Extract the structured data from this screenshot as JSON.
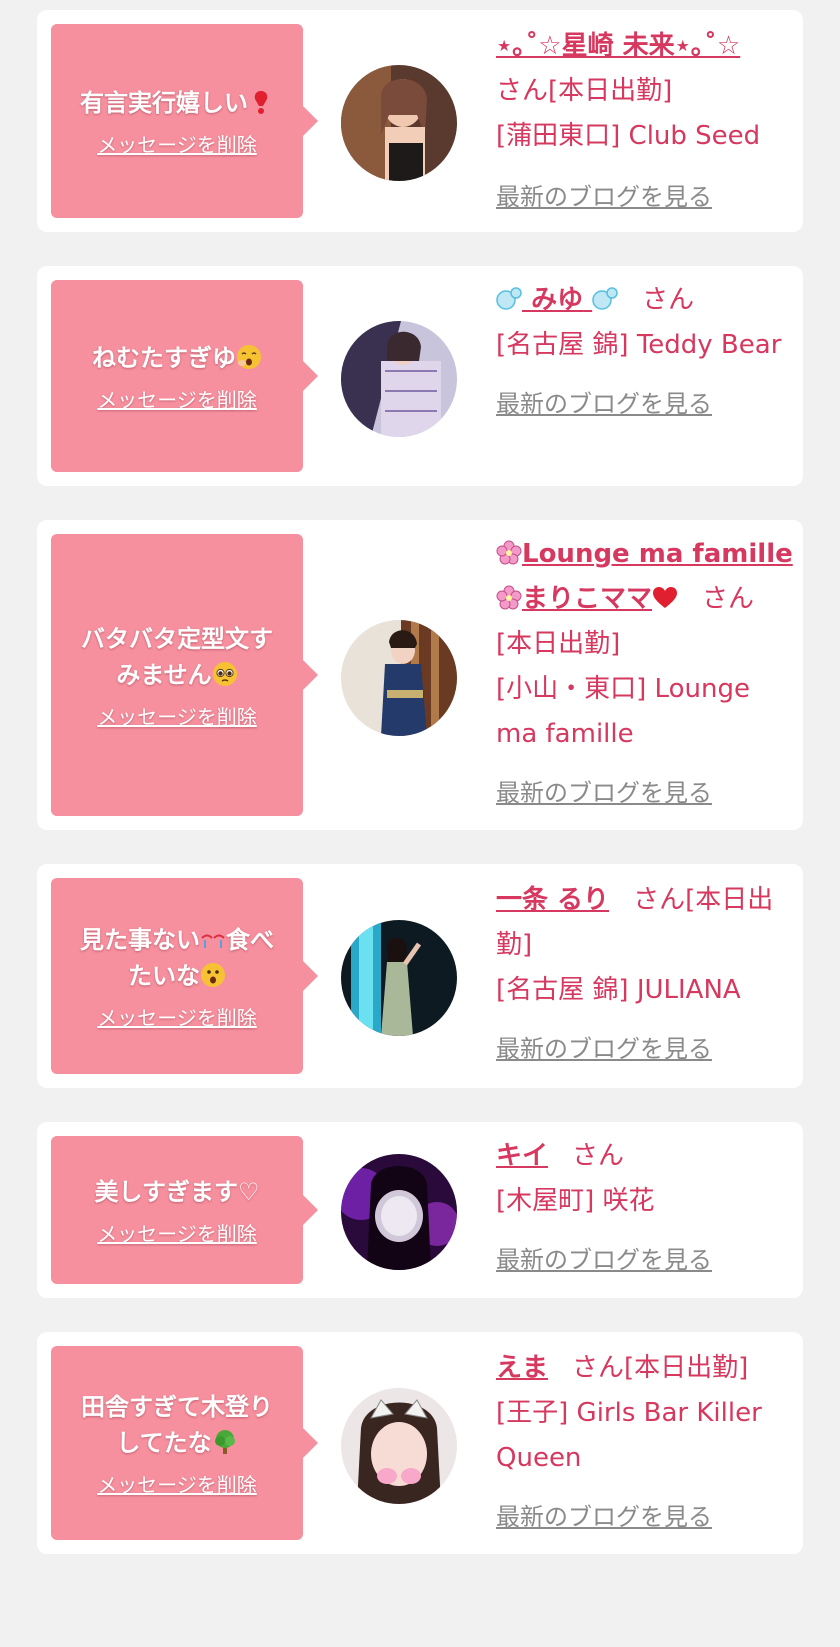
{
  "delete_label": "メッセージを削除",
  "blog_label": "最新のブログを見る",
  "honorific": "さん",
  "colors": {
    "bubble": "#f7909e",
    "accent": "#d6385f",
    "link_gray": "#8a8a8a",
    "background": "#f1f1f1"
  },
  "items": [
    {
      "message": "有言実行嬉しい",
      "message_emoji": "red-exclamation-icon",
      "name": "⋆｡˚☆星崎 未来⋆｡˚☆",
      "status": "[本日出勤]",
      "location": "[蒲田東口] Club Seed"
    },
    {
      "message": "ねむたすぎゆ",
      "message_emoji": "yawning-face-icon",
      "name": "みゆ",
      "name_emoji": "bubbles-icon",
      "status": "",
      "location": "[名古屋 錦] Teddy Bear"
    },
    {
      "message_line1": "バタバタ定型文す",
      "message_line2": "みません",
      "message_emoji": "pleading-face-icon",
      "name_line1": "Lounge ma famille",
      "name_line2": "まりこママ",
      "name_emoji": "cherry-blossom-icon",
      "name_end_emoji": "red-heart-icon",
      "status": "[本日出勤]",
      "location": "[小山・東口] Lounge ma famille"
    },
    {
      "message_line1": "見た事ない",
      "message_line1_end": "食べ",
      "message_line2": "たいな",
      "message_emoji1": "tearful-eyes-icon",
      "message_emoji2": "surprised-face-icon",
      "name": "一条 るり",
      "status": "[本日出勤]",
      "location": "[名古屋 錦] JULIANA"
    },
    {
      "message": "美しすぎます♡",
      "name": "キイ",
      "status": "",
      "location": "[木屋町] 咲花"
    },
    {
      "message_line1": "田舎すぎて木登り",
      "message_line2": "してたな",
      "message_emoji": "tree-icon",
      "name": "えま",
      "status": "[本日出勤]",
      "location": "[王子] Girls Bar Killer Queen"
    }
  ]
}
